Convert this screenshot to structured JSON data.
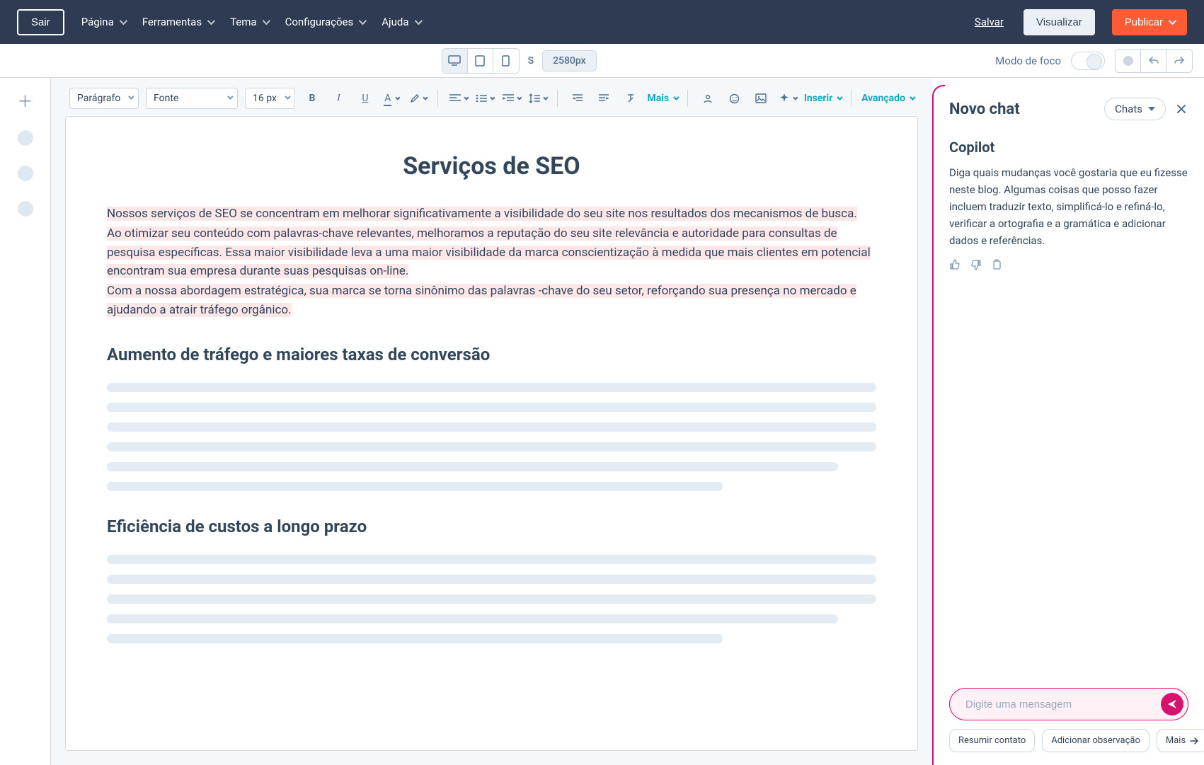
{
  "topnav": {
    "exit": "Sair",
    "menu": [
      "Página",
      "Ferramentas",
      "Tema",
      "Configurações",
      "Ajuda"
    ],
    "save": "Salvar",
    "preview": "Visualizar",
    "publish": "Publicar"
  },
  "subbar": {
    "size_letter": "S",
    "size_value": "2580px",
    "focus_label": "Modo de foco"
  },
  "rt_toolbar": {
    "paragraph": "Parágrafo",
    "font": "Fonte",
    "fontsize": "16 px",
    "more": "Mais",
    "insert": "Inserir",
    "advanced": "Avançado"
  },
  "document": {
    "title": "Serviços de SEO",
    "p1": "Nossos serviços de SEO se concentram em melhorar significativamente a visibilidade do seu site nos resultados dos mecanismos de busca.",
    "p2": "Ao otimizar seu conteúdo com palavras-chave relevantes, melhoramos a reputação do seu site relevância e autoridade para consultas de pesquisa específicas. Essa maior visibilidade leva a uma maior visibilidade da marca conscientização à medida que mais clientes em potencial encontram sua empresa durante suas pesquisas on-line.",
    "p3": "Com a nossa abordagem estratégica, sua marca se torna sinônimo das palavras -chave do seu setor, reforçando sua presença no mercado e ajudando a atrair tráfego orgânico.",
    "h2a": "Aumento de tráfego e maiores taxas de conversão",
    "h2b": "Eficiência de custos a longo prazo"
  },
  "copilot": {
    "header": "Novo chat",
    "chats": "Chats",
    "heading": "Copilot",
    "intro": "Diga quais mudanças você gostaria que eu fizesse neste blog. Algumas coisas que posso fazer incluem traduzir texto, simplificá-lo e refiná-lo, verificar a ortografia e a gramática e adicionar dados e referências.",
    "placeholder": "Digite uma mensagem",
    "chips": [
      "Resumir contato",
      "Adicionar observação",
      "Mais"
    ]
  }
}
